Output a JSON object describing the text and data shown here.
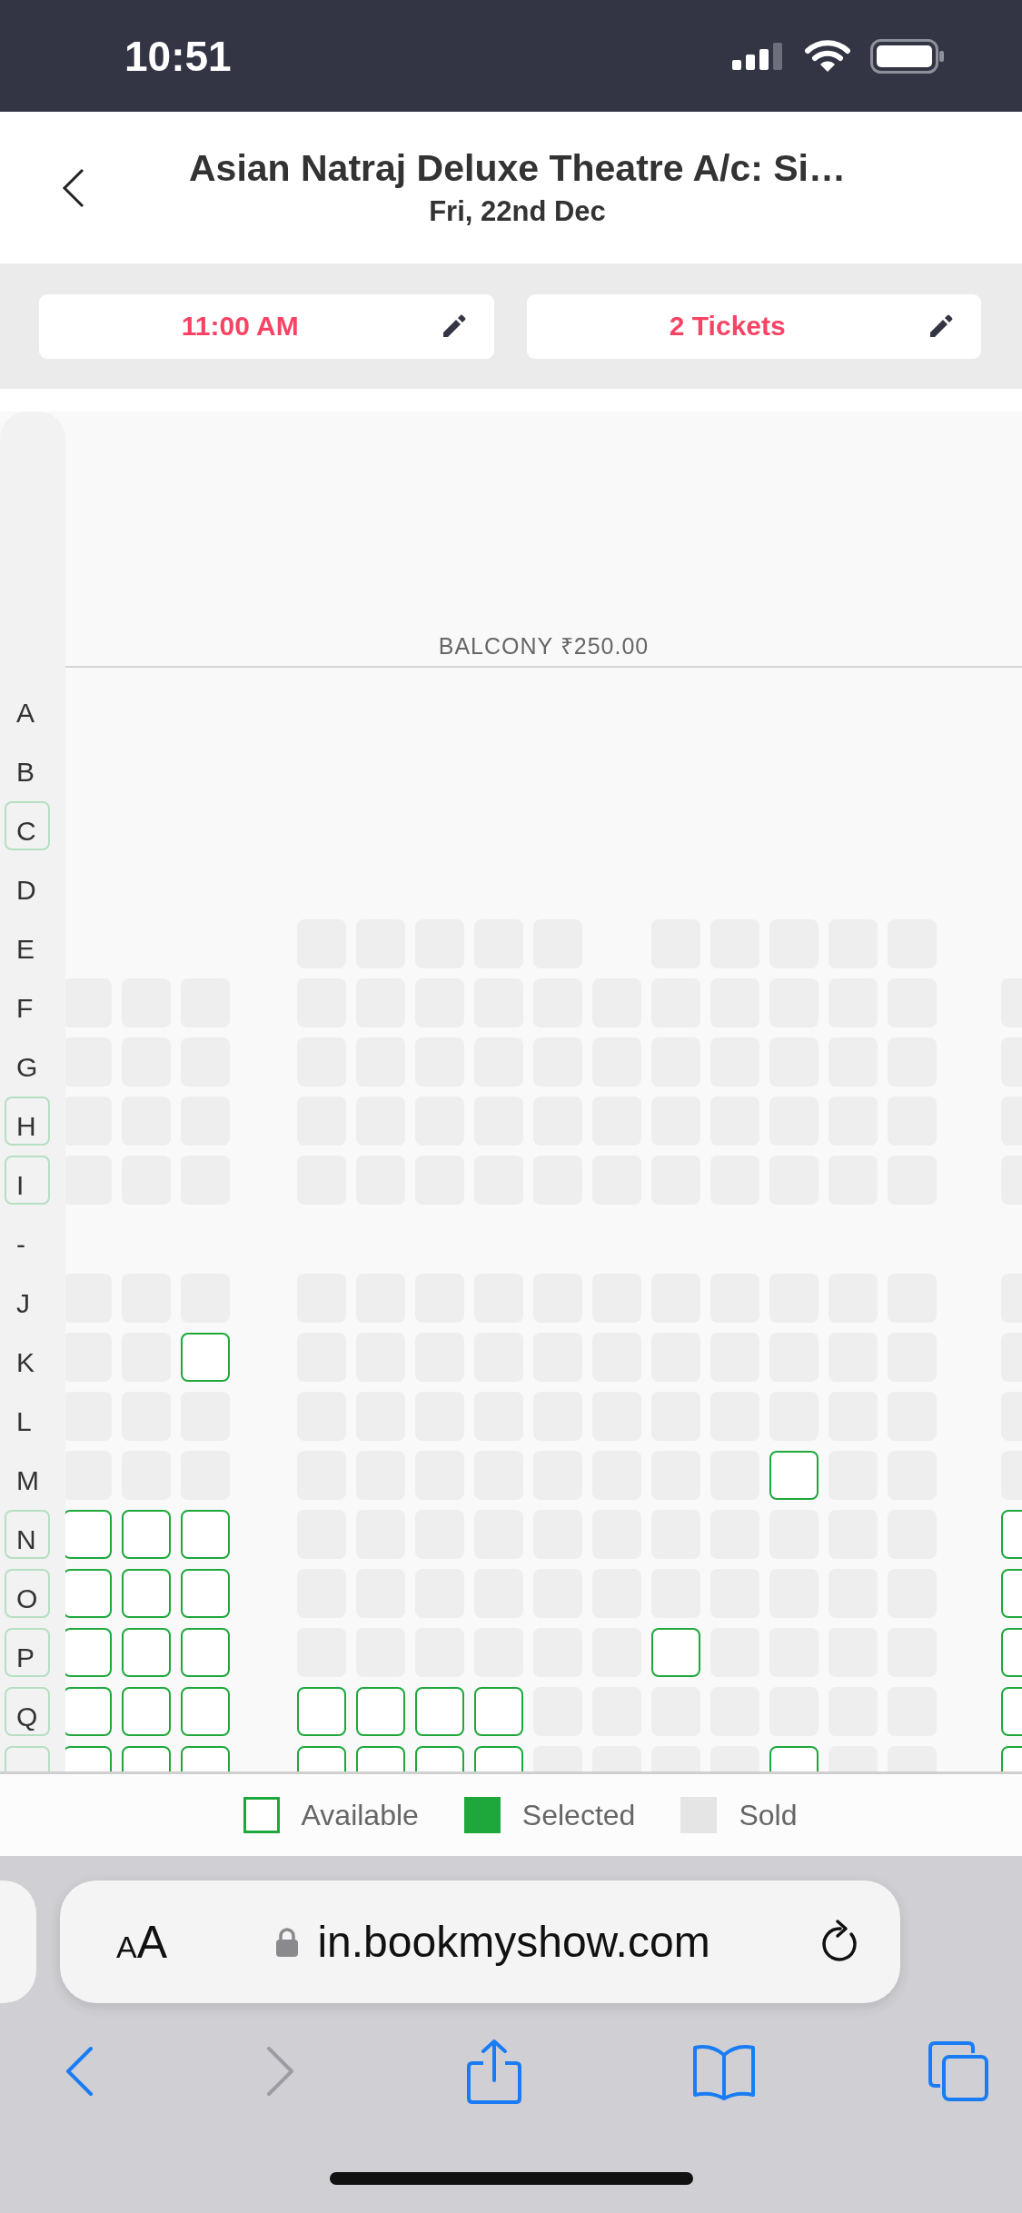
{
  "status_bar": {
    "time": "10:51"
  },
  "header": {
    "title": "Asian Natraj Deluxe Theatre A/c: Si…",
    "subtitle": "Fri, 22nd Dec"
  },
  "selectors": [
    {
      "label": "11:00 AM"
    },
    {
      "label": "2 Tickets"
    }
  ],
  "seat_map": {
    "section": "BALCONY ₹250.00",
    "rows": [
      {
        "label": "A",
        "highlighted": false
      },
      {
        "label": "B",
        "highlighted": false
      },
      {
        "label": "C",
        "highlighted": true
      },
      {
        "label": "D",
        "highlighted": false
      },
      {
        "label": "E",
        "highlighted": false,
        "seats": [
          {
            "empty": true
          },
          {
            "empty": true
          },
          {
            "empty": true
          },
          {
            "available": false
          },
          {
            "available": false
          },
          {
            "available": false
          },
          {
            "available": false
          },
          {
            "available": false
          },
          {
            "empty": true
          },
          {
            "available": false
          },
          {
            "available": false
          },
          {
            "available": false
          },
          {
            "available": false
          },
          {
            "available": false
          },
          {
            "empty": true
          }
        ]
      },
      {
        "label": "F",
        "highlighted": false,
        "seats": [
          {
            "available": false
          },
          {
            "available": false
          },
          {
            "available": false
          },
          {
            "available": false
          },
          {
            "available": false
          },
          {
            "available": false
          },
          {
            "available": false
          },
          {
            "available": false
          },
          {
            "available": false
          },
          {
            "available": false
          },
          {
            "available": false
          },
          {
            "available": false
          },
          {
            "available": false
          },
          {
            "available": false
          },
          {
            "available": false
          }
        ]
      },
      {
        "label": "G",
        "highlighted": false,
        "seats": [
          {
            "available": false
          },
          {
            "available": false
          },
          {
            "available": false
          },
          {
            "available": false
          },
          {
            "available": false
          },
          {
            "available": false
          },
          {
            "available": false
          },
          {
            "available": false
          },
          {
            "available": false
          },
          {
            "available": false
          },
          {
            "available": false
          },
          {
            "available": false
          },
          {
            "available": false
          },
          {
            "available": false
          },
          {
            "available": false
          }
        ]
      },
      {
        "label": "H",
        "highlighted": true,
        "seats": [
          {
            "available": false
          },
          {
            "available": false
          },
          {
            "available": false
          },
          {
            "available": false
          },
          {
            "available": false
          },
          {
            "available": false
          },
          {
            "available": false
          },
          {
            "available": false
          },
          {
            "available": false
          },
          {
            "available": false
          },
          {
            "available": false
          },
          {
            "available": false
          },
          {
            "available": false
          },
          {
            "available": false
          },
          {
            "available": false
          }
        ]
      },
      {
        "label": "I",
        "highlighted": true,
        "seats": [
          {
            "available": false
          },
          {
            "available": false
          },
          {
            "available": false
          },
          {
            "available": false
          },
          {
            "available": false
          },
          {
            "available": false
          },
          {
            "available": false
          },
          {
            "available": false
          },
          {
            "available": false
          },
          {
            "available": false
          },
          {
            "available": false
          },
          {
            "available": false
          },
          {
            "available": false
          },
          {
            "available": false
          },
          {
            "available": false
          }
        ]
      },
      {
        "label": "-",
        "highlighted": false
      },
      {
        "label": "J",
        "highlighted": false,
        "seats": [
          {
            "available": false
          },
          {
            "available": false
          },
          {
            "available": false
          },
          {
            "available": false
          },
          {
            "available": false
          },
          {
            "available": false
          },
          {
            "available": false
          },
          {
            "available": false
          },
          {
            "available": false
          },
          {
            "available": false
          },
          {
            "available": false
          },
          {
            "available": false
          },
          {
            "available": false
          },
          {
            "available": false
          },
          {
            "available": false
          }
        ]
      },
      {
        "label": "K",
        "highlighted": false,
        "seats": [
          {
            "available": false
          },
          {
            "available": false
          },
          {
            "available": true
          },
          {
            "available": false
          },
          {
            "available": false
          },
          {
            "available": false
          },
          {
            "available": false
          },
          {
            "available": false
          },
          {
            "available": false
          },
          {
            "available": false
          },
          {
            "available": false
          },
          {
            "available": false
          },
          {
            "available": false
          },
          {
            "available": false
          },
          {
            "available": false
          }
        ]
      },
      {
        "label": "L",
        "highlighted": false,
        "seats": [
          {
            "available": false
          },
          {
            "available": false
          },
          {
            "available": false
          },
          {
            "available": false
          },
          {
            "available": false
          },
          {
            "available": false
          },
          {
            "available": false
          },
          {
            "available": false
          },
          {
            "available": false
          },
          {
            "available": false
          },
          {
            "available": false
          },
          {
            "available": false
          },
          {
            "available": false
          },
          {
            "available": false
          },
          {
            "available": false
          }
        ]
      },
      {
        "label": "M",
        "highlighted": false,
        "seats": [
          {
            "available": false
          },
          {
            "available": false
          },
          {
            "available": false
          },
          {
            "available": false
          },
          {
            "available": false
          },
          {
            "available": false
          },
          {
            "available": false
          },
          {
            "available": false
          },
          {
            "available": false
          },
          {
            "available": false
          },
          {
            "available": false
          },
          {
            "available": true
          },
          {
            "available": false
          },
          {
            "available": false
          },
          {
            "available": false
          }
        ]
      },
      {
        "label": "N",
        "highlighted": true,
        "seats": [
          {
            "available": true
          },
          {
            "available": true
          },
          {
            "available": true
          },
          {
            "available": false
          },
          {
            "available": false
          },
          {
            "available": false
          },
          {
            "available": false
          },
          {
            "available": false
          },
          {
            "available": false
          },
          {
            "available": false
          },
          {
            "available": false
          },
          {
            "available": false
          },
          {
            "available": false
          },
          {
            "available": false
          },
          {
            "available": true
          }
        ]
      },
      {
        "label": "O",
        "highlighted": true,
        "seats": [
          {
            "available": true
          },
          {
            "available": true
          },
          {
            "available": true
          },
          {
            "available": false
          },
          {
            "available": false
          },
          {
            "available": false
          },
          {
            "available": false
          },
          {
            "available": false
          },
          {
            "available": false
          },
          {
            "available": false
          },
          {
            "available": false
          },
          {
            "available": false
          },
          {
            "available": false
          },
          {
            "available": false
          },
          {
            "available": true
          }
        ]
      },
      {
        "label": "P",
        "highlighted": true,
        "seats": [
          {
            "available": true
          },
          {
            "available": true
          },
          {
            "available": true
          },
          {
            "available": false
          },
          {
            "available": false
          },
          {
            "available": false
          },
          {
            "available": false
          },
          {
            "available": false
          },
          {
            "available": false
          },
          {
            "available": true
          },
          {
            "available": false
          },
          {
            "available": false
          },
          {
            "available": false
          },
          {
            "available": false
          },
          {
            "available": true
          }
        ]
      },
      {
        "label": "Q",
        "highlighted": true,
        "seats": [
          {
            "available": true
          },
          {
            "available": true
          },
          {
            "available": true
          },
          {
            "available": true
          },
          {
            "available": true
          },
          {
            "available": true
          },
          {
            "available": true
          },
          {
            "available": false
          },
          {
            "available": false
          },
          {
            "available": false
          },
          {
            "available": false
          },
          {
            "available": false
          },
          {
            "available": false
          },
          {
            "available": false
          },
          {
            "available": true
          }
        ]
      },
      {
        "highlighted": true,
        "seats": [
          {
            "available": true
          },
          {
            "available": true
          },
          {
            "available": true
          },
          {
            "available": true
          },
          {
            "available": true
          },
          {
            "available": true
          },
          {
            "available": true
          },
          {
            "available": false
          },
          {
            "available": false
          },
          {
            "available": false
          },
          {
            "available": false
          },
          {
            "available": true
          },
          {
            "available": false
          },
          {
            "available": false
          },
          {
            "available": true
          }
        ]
      }
    ]
  },
  "legend": [
    {
      "label": "Available",
      "kind": "available"
    },
    {
      "label": "Selected",
      "kind": "selected"
    },
    {
      "label": "Sold",
      "kind": "sold"
    }
  ],
  "browser": {
    "text_size": "AA",
    "url": "in.bookmyshow.com"
  }
}
